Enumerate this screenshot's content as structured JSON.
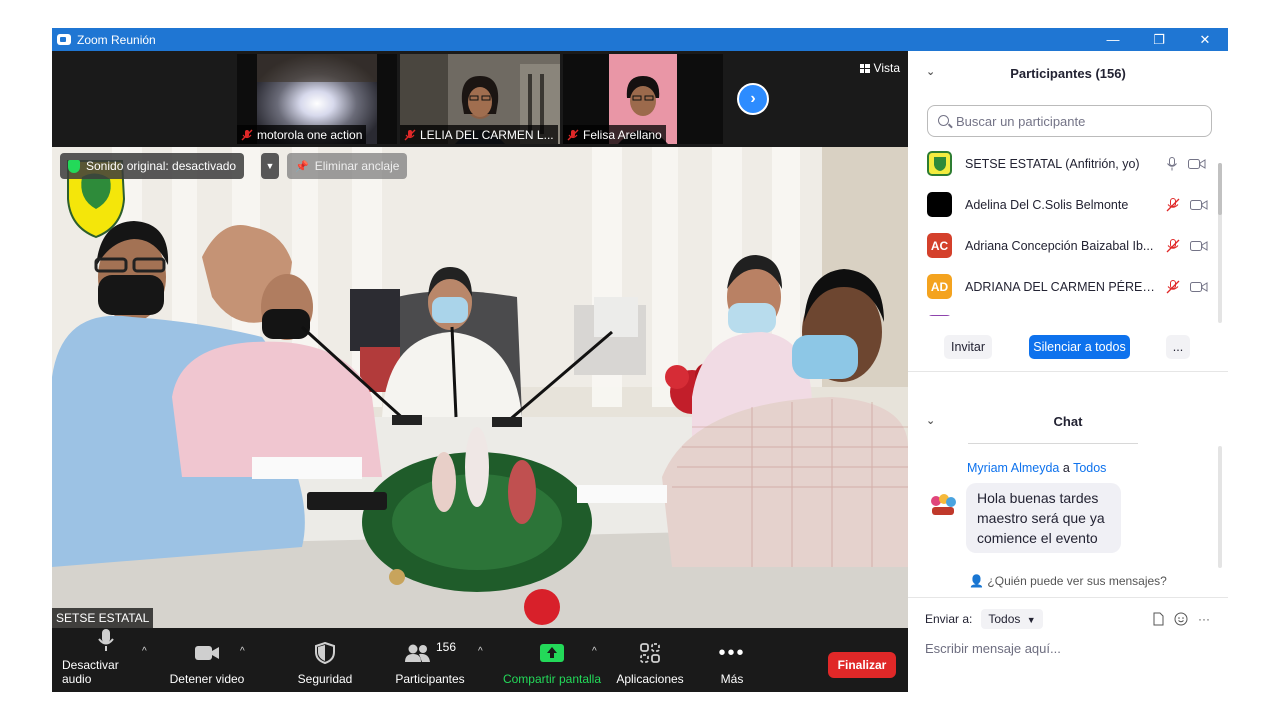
{
  "window": {
    "title": "Zoom Reunión",
    "controls": [
      "—",
      "❐",
      "✕"
    ]
  },
  "thumbnails": [
    {
      "name": "motorola one action",
      "muted": true
    },
    {
      "name": "LELIA DEL CARMEN L...",
      "muted": true
    },
    {
      "name": "Felisa Arellano",
      "muted": true
    }
  ],
  "view_button": {
    "label": "Vista"
  },
  "main_video": {
    "speaker_label": "SETSE ESTATAL",
    "sound_pill": "Sonido original: desactivado",
    "unpin_label": "Eliminar anclaje"
  },
  "toolbar": {
    "mute_audio": "Desactivar audio",
    "stop_video": "Detener video",
    "security": "Seguridad",
    "participants": "Participantes",
    "participants_count": "156",
    "share_screen": "Compartir pantalla",
    "apps": "Aplicaciones",
    "more": "Más",
    "end": "Finalizar"
  },
  "participants_panel": {
    "title": "Participantes (156)",
    "search_placeholder": "Buscar un participante",
    "items": [
      {
        "name": "SETSE ESTATAL (Anfitrión, yo)",
        "avatar": "logo",
        "initials": "",
        "color": "#e8e100",
        "mic": "on"
      },
      {
        "name": "Adelina Del C.Solis Belmonte",
        "avatar": "photo",
        "initials": "",
        "color": "#000000",
        "mic": "off"
      },
      {
        "name": "Adriana Concepción Baizabal Ib...",
        "avatar": "initials",
        "initials": "AC",
        "color": "#d4402b",
        "mic": "off"
      },
      {
        "name": "ADRIANA DEL CARMEN PÉREZ ...",
        "avatar": "initials",
        "initials": "AD",
        "color": "#f4a31f",
        "mic": "off"
      },
      {
        "name": "",
        "avatar": "initials",
        "initials": "",
        "color": "#8e44ad",
        "mic": "off"
      }
    ],
    "invite": "Invitar",
    "mute_all": "Silenciar a todos",
    "more": "..."
  },
  "chat_panel": {
    "title": "Chat",
    "message": {
      "sender": "Myriam Almeyda",
      "to_word": "a",
      "recipient": "Todos",
      "text": "Hola buenas tardes maestro será que ya comience el evento"
    },
    "who_sees": "¿Quién puede ver sus mensajes?",
    "send_to_label": "Enviar a:",
    "send_to_value": "Todos",
    "input_placeholder": "Escribir mensaje aquí..."
  },
  "colors": {
    "titlebar": "#1f76d3",
    "accent_blue": "#0e72ed",
    "share_green": "#23d959",
    "end_red": "#e02828"
  }
}
